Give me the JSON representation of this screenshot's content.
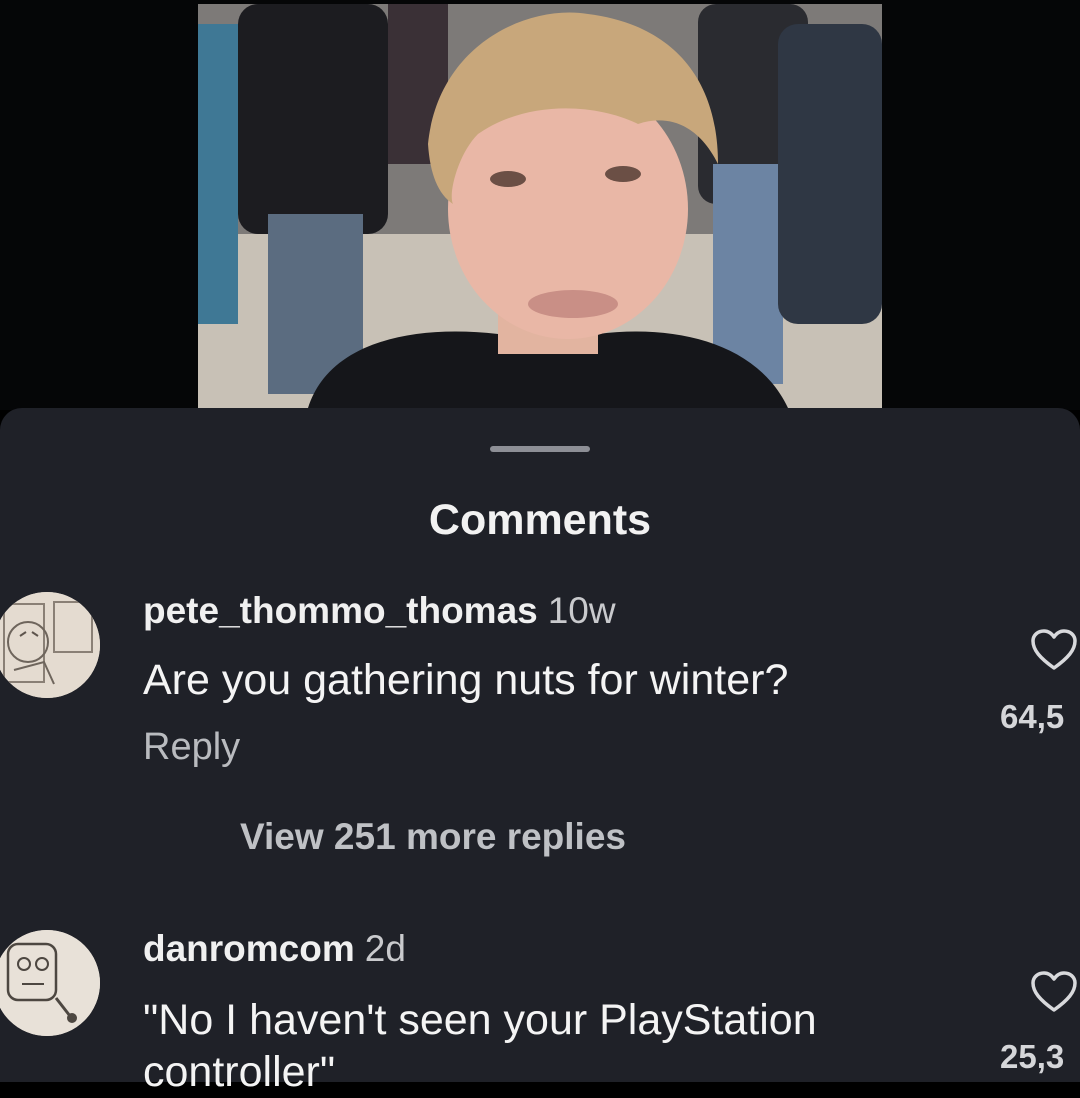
{
  "sheet": {
    "title": "Comments"
  },
  "comments": [
    {
      "username": "pete_thommo_thomas",
      "time": "10w",
      "text": "Are you gathering nuts for winter?",
      "reply_label": "Reply",
      "likes": "64,5",
      "view_replies": "View 251 more replies"
    },
    {
      "username": "danromcom",
      "time": "2d",
      "text": "\"No I haven't seen your PlayStation controller\"",
      "likes": "25,3"
    }
  ],
  "colors": {
    "sheet_bg": "#1f2128",
    "text_primary": "#f4f4f4",
    "text_secondary": "#b9bbbf"
  },
  "icons": [
    "heart-icon"
  ]
}
